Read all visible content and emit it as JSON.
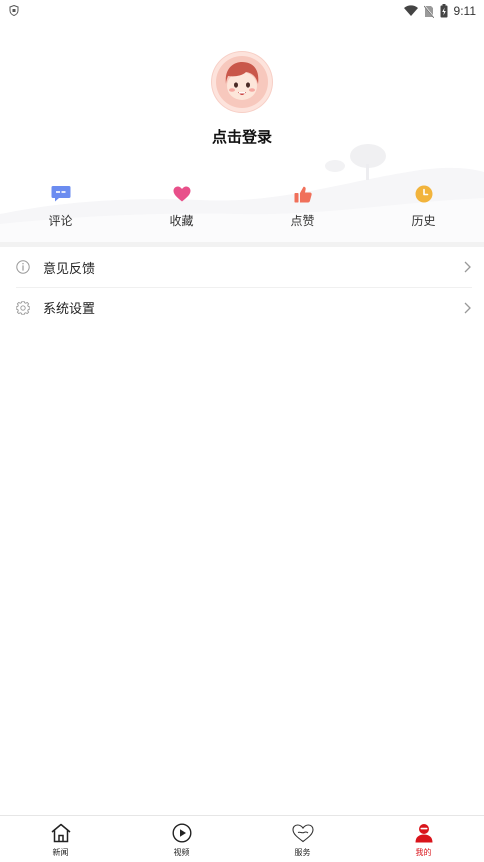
{
  "status_bar": {
    "time": "9:11"
  },
  "profile": {
    "login_text": "点击登录"
  },
  "actions": [
    {
      "label": "评论",
      "icon": "comment-icon",
      "color": "#6b8cf0"
    },
    {
      "label": "收藏",
      "icon": "heart-icon",
      "color": "#e8508a"
    },
    {
      "label": "点赞",
      "icon": "thumbs-up-icon",
      "color": "#f0705a"
    },
    {
      "label": "历史",
      "icon": "clock-icon",
      "color": "#f2b43c"
    }
  ],
  "menu": [
    {
      "label": "意见反馈",
      "icon": "info-icon"
    },
    {
      "label": "系统设置",
      "icon": "gear-icon"
    }
  ],
  "tabs": [
    {
      "label": "新闻",
      "icon": "home-icon",
      "active": false
    },
    {
      "label": "视频",
      "icon": "play-icon",
      "active": false
    },
    {
      "label": "服务",
      "icon": "heart-outline-icon",
      "active": false
    },
    {
      "label": "我的",
      "icon": "user-icon",
      "active": true
    }
  ],
  "colors": {
    "accent": "#d9141b",
    "divider": "#f2f2f2"
  }
}
